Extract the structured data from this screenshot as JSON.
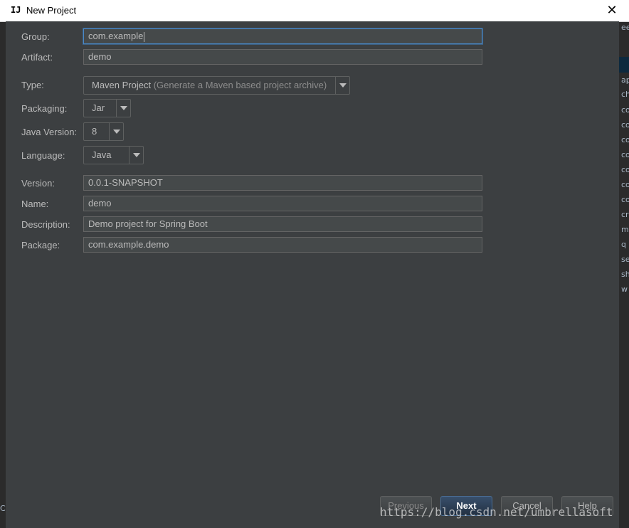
{
  "window": {
    "title": "New Project",
    "icon": "intellij-icon"
  },
  "form": {
    "group": {
      "label": "Group:",
      "value": "com.example"
    },
    "artifact": {
      "label": "Artifact:",
      "value": "demo"
    },
    "type": {
      "label": "Type:",
      "value": "Maven Project",
      "hint": "(Generate a Maven based project archive)"
    },
    "packaging": {
      "label": "Packaging:",
      "value": "Jar"
    },
    "java_version": {
      "label": "Java Version:",
      "value": "8"
    },
    "language": {
      "label": "Language:",
      "value": "Java"
    },
    "version": {
      "label": "Version:",
      "value": "0.0.1-SNAPSHOT"
    },
    "name": {
      "label": "Name:",
      "value": "demo"
    },
    "description": {
      "label": "Description:",
      "value": "Demo project for Spring Boot"
    },
    "package": {
      "label": "Package:",
      "value": "com.example.demo"
    }
  },
  "buttons": {
    "previous": "Previous",
    "next": "Next",
    "cancel": "Cancel",
    "help": "Help"
  },
  "watermark": "https://blog.csdn.net/umbrellasoft",
  "background_fragments": [
    "ee",
    "ap",
    "ch",
    "co",
    "co",
    "co",
    "co",
    "co",
    "co",
    "co",
    "cr",
    "m",
    "q",
    "se",
    "sh",
    "w"
  ],
  "colors": {
    "dialog_bg": "#3c3f41",
    "field_bg": "#45494a",
    "focus_border": "#4a88c7",
    "primary_button": "#365880"
  }
}
